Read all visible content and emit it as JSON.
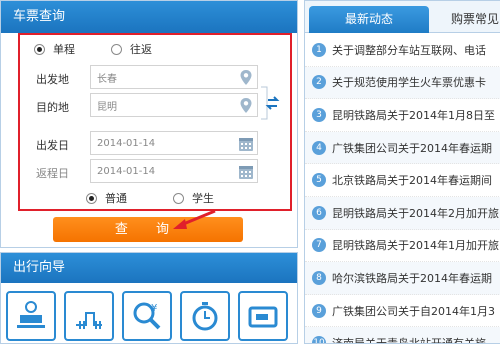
{
  "ticket": {
    "header": "车票查询",
    "trip_types": [
      "单程",
      "往返"
    ],
    "from_label": "出发地",
    "from_value": "长春",
    "to_label": "目的地",
    "to_value": "昆明",
    "depart_label": "出发日",
    "depart_value": "2014-01-14",
    "return_label": "返程日",
    "return_value": "2014-01-14",
    "ticket_types": [
      "普通",
      "学生"
    ],
    "query_button": "查 询"
  },
  "guide": {
    "header": "出行向导",
    "icons": [
      "train-station-icon",
      "railway-map-icon",
      "price-search-icon",
      "clock-icon",
      "ticket-icon"
    ]
  },
  "news": {
    "tabs": [
      "最新动态",
      "购票常见"
    ],
    "items": [
      {
        "num": "1",
        "text": "关于调整部分车站互联网、电话"
      },
      {
        "num": "2",
        "text": "关于规范使用学生火车票优惠卡"
      },
      {
        "num": "3",
        "text": "昆明铁路局关于2014年1月8日至"
      },
      {
        "num": "4",
        "text": "广铁集团公司关于2014年春运期"
      },
      {
        "num": "5",
        "text": "北京铁路局关于2014年春运期间"
      },
      {
        "num": "6",
        "text": "昆明铁路局关于2014年2月加开旅"
      },
      {
        "num": "7",
        "text": "昆明铁路局关于2014年1月加开旅"
      },
      {
        "num": "8",
        "text": "哈尔滨铁路局关于2014年春运期"
      },
      {
        "num": "9",
        "text": "广铁集团公司关于自2014年1月3"
      },
      {
        "num": "10",
        "text": "济南局关于青岛北站开通有关旅"
      }
    ]
  },
  "colors": {
    "header_blue": "#1b74bf",
    "highlight_red": "#e0202b",
    "button_orange": "#f57300",
    "icon_blue": "#2a8ad2"
  }
}
